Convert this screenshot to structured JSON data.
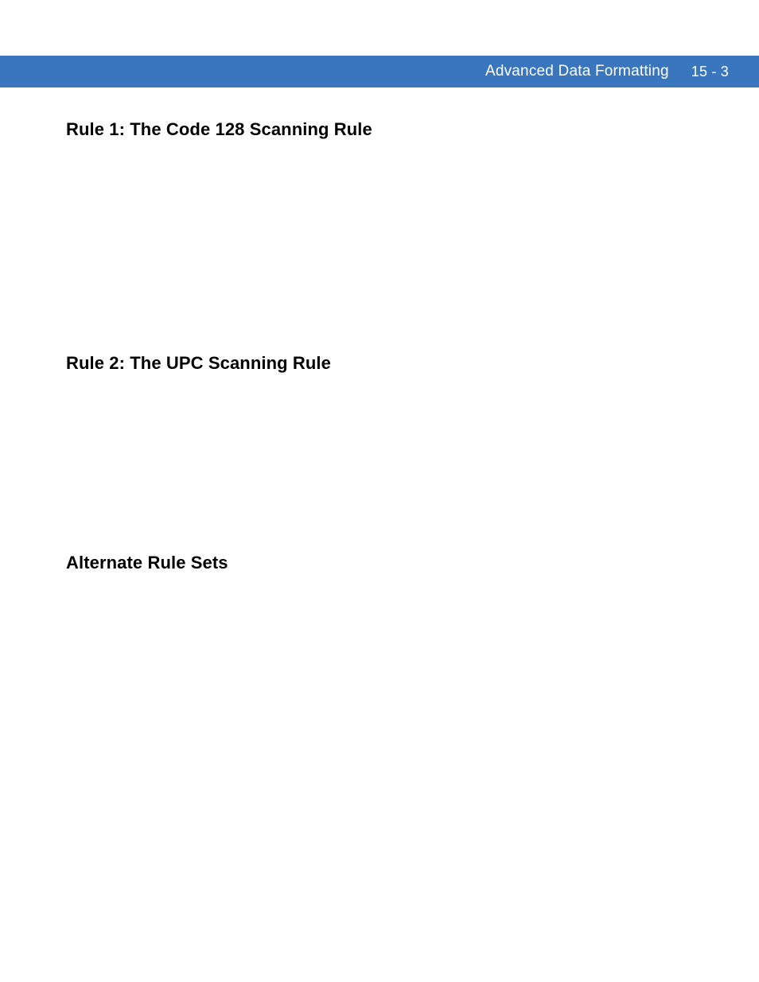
{
  "header": {
    "title": "Advanced Data Formatting",
    "page_number": "15 - 3"
  },
  "sections": {
    "rule1_heading": "Rule 1: The Code 128 Scanning Rule",
    "rule2_heading": "Rule 2: The UPC Scanning Rule",
    "alternate_heading": "Alternate Rule Sets"
  }
}
